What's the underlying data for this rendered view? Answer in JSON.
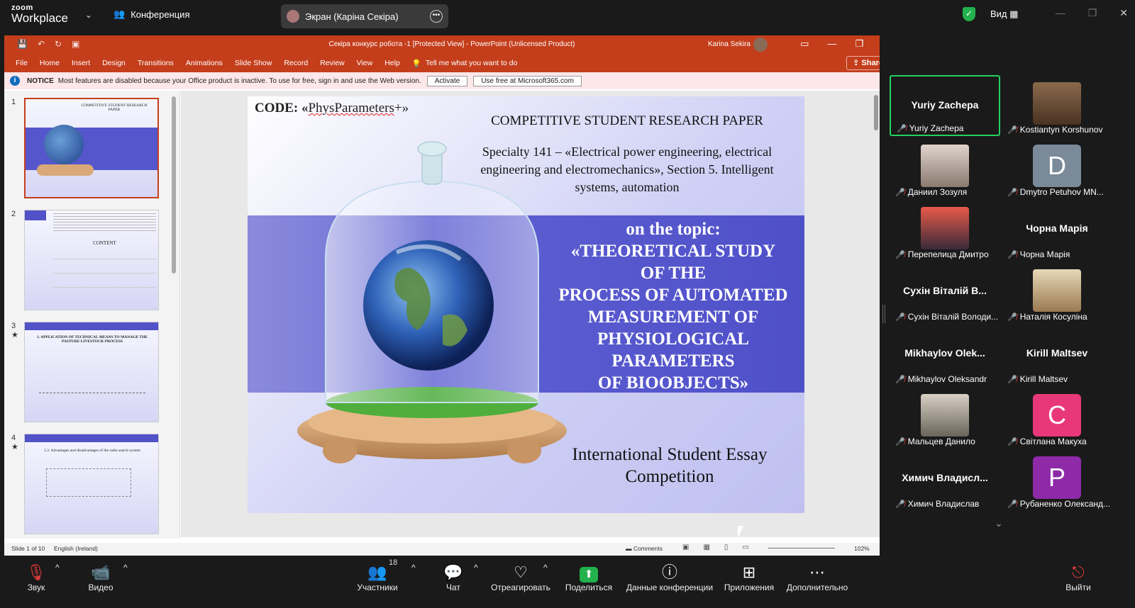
{
  "zoom": {
    "logo_line1": "zoom",
    "logo_line2": "Workplace",
    "conference_label": "Конференция",
    "screen_share_label": "Экран (Каріна Секіра)",
    "view_label": "Вид"
  },
  "ppt": {
    "window_title": "Секіра конкурс робота -1 [Protected View]  -  PowerPoint (Unlicensed Product)",
    "user_name": "Karina Sekira",
    "menu": [
      "File",
      "Home",
      "Insert",
      "Design",
      "Transitions",
      "Animations",
      "Slide Show",
      "Record",
      "Review",
      "View",
      "Help"
    ],
    "tell_me": "Tell me what you want to do",
    "share_label": "Share",
    "notice_label": "NOTICE",
    "notice_text": "Most features are disabled because your Office product is inactive. To use for free, sign in and use the Web version.",
    "activate_label": "Activate",
    "use_free_label": "Use free at Microsoft365.com",
    "thumbnails": [
      {
        "num": "1",
        "text": "COMPETITIVE STUDENT RESEARCH PAPER"
      },
      {
        "num": "2",
        "text": "CONTENT"
      },
      {
        "num": "3",
        "text": "1. APPLICATION OF TECHNICAL MEANS TO MANAGE THE PASTURE LIVESTOCK PROCESS"
      },
      {
        "num": "4",
        "text": "1.2. Advantages and disadvantages of the radio search system"
      }
    ],
    "slide": {
      "code_prefix": "CODE: «",
      "code_value": "PhysParameters",
      "code_suffix": "+»",
      "title": "COMPETITIVE STUDENT RESEARCH PAPER",
      "specialty": "Specialty 141 – «Electrical power engineering, electrical engineering and electromechanics», Section 5. Intelligent systems, automation",
      "topic_lines": [
        "on the topic:",
        "«THEORETICAL STUDY",
        "OF THE",
        "PROCESS OF AUTOMATED",
        "MEASUREMENT OF",
        "PHYSIOLOGICAL",
        "PARAMETERS",
        "OF BIOOBJECTS»"
      ],
      "competition": "International Student Essay Competition"
    },
    "status": {
      "slide_count": "Slide 1 of 10",
      "language": "English (Ireland)",
      "comments": "Comments",
      "zoom": "102%"
    }
  },
  "participants": [
    {
      "name": "Yuriy Zachepa",
      "display": "Yuriy Zachepa",
      "type": "text",
      "active": true
    },
    {
      "name": "Kostiantyn Korshunov",
      "type": "photo",
      "color": "#6b4a36"
    },
    {
      "name": "Даниил Зозуля",
      "type": "photo",
      "color": "#c9b8b0"
    },
    {
      "name": "Dmytro Petuhov MN...",
      "type": "letter",
      "letter": "D",
      "color": "#7a8a99"
    },
    {
      "name": "Перепелица Дмитро",
      "type": "photo",
      "color": "#d2423a"
    },
    {
      "name": "Чорна Марія",
      "display": "Чорна Марія",
      "type": "text"
    },
    {
      "name": "Сухін Віталій Володи...",
      "display": "Сухін Віталій В...",
      "type": "text"
    },
    {
      "name": "Наталія Косуліна",
      "type": "photo",
      "color": "#c8a070"
    },
    {
      "name": "Mikhaylov Oleksandr",
      "display": "Mikhaylov  Olek...",
      "type": "text"
    },
    {
      "name": "Kirill Maltsev",
      "display": "Kirill Maltsev",
      "type": "text"
    },
    {
      "name": "Мальцев Данило",
      "type": "photo",
      "color": "#b8b0a4"
    },
    {
      "name": "Світлана Макуха",
      "type": "letter",
      "letter": "C",
      "color": "#e8387a"
    },
    {
      "name": "Химич Владислав",
      "display": "Химич  Владисл...",
      "type": "text"
    },
    {
      "name": "Рубаненко Олександ...",
      "type": "letter",
      "letter": "P",
      "color": "#8e2aa8"
    }
  ],
  "toolbar": {
    "audio": "Звук",
    "video": "Видео",
    "participants": "Участники",
    "participants_count": "18",
    "chat": "Чат",
    "react": "Отреагировать",
    "share": "Поделиться",
    "info": "Данные конференции",
    "apps": "Приложения",
    "more": "Дополнительно",
    "leave": "Выйти"
  },
  "colors": {
    "ppt_accent": "#c43e1c",
    "zoom_green": "#23b14d",
    "active_speaker": "#23d160"
  }
}
